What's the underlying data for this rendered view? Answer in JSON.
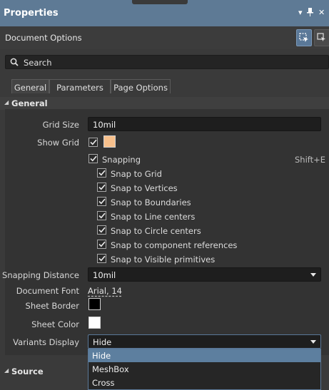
{
  "panel": {
    "title": "Properties"
  },
  "header": {
    "doc_options_label": "Document Options"
  },
  "search": {
    "placeholder": "Search"
  },
  "tabs": [
    {
      "label": "General",
      "active": true
    },
    {
      "label": "Parameters",
      "active": false
    },
    {
      "label": "Page Options",
      "active": false
    }
  ],
  "general": {
    "section_label": "General",
    "grid_size": {
      "label": "Grid Size",
      "value": "10mil"
    },
    "show_grid": {
      "label": "Show Grid",
      "checked": true,
      "color": "#f7c08c"
    },
    "snapping": {
      "label": "Snapping",
      "shortcut": "Shift+E",
      "checked": true
    },
    "snap_options": [
      {
        "label": "Snap to Grid",
        "checked": true
      },
      {
        "label": "Snap to Vertices",
        "checked": true
      },
      {
        "label": "Snap to Boundaries",
        "checked": true
      },
      {
        "label": "Snap to Line centers",
        "checked": true
      },
      {
        "label": "Snap to Circle centers",
        "checked": true
      },
      {
        "label": "Snap to component references",
        "checked": true
      },
      {
        "label": "Snap to Visible primitives",
        "checked": true
      }
    ],
    "snapping_distance": {
      "label": "Snapping Distance",
      "value": "10mil"
    },
    "document_font": {
      "label": "Document Font",
      "value": "Arial, 14"
    },
    "sheet_border": {
      "label": "Sheet Border",
      "color": "#000000"
    },
    "sheet_color": {
      "label": "Sheet Color",
      "color": "#ffffff"
    },
    "variants_display": {
      "label": "Variants Display",
      "value": "Hide",
      "options": [
        "Hide",
        "MeshBox",
        "Cross"
      ]
    }
  },
  "source": {
    "section_label": "Source"
  },
  "colors": {
    "title_bar": "#5e7a95",
    "accent": "#5d7f9f"
  }
}
